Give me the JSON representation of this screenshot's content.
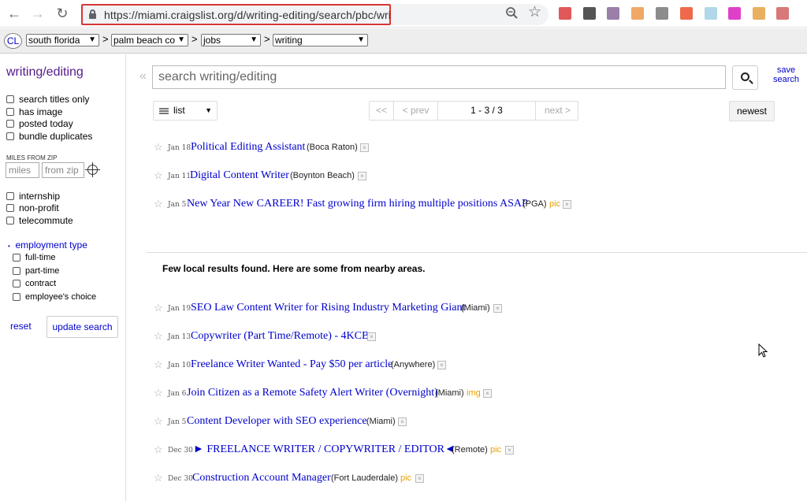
{
  "browser": {
    "url": "https://miami.craigslist.org/d/writing-editing/search/pbc/wri",
    "back_glyph": "←",
    "forward_glyph": "→",
    "reload_glyph": "↻",
    "star_glyph": "☆"
  },
  "header": {
    "logo": "CL",
    "sep": ">",
    "crumbs": [
      "south florida",
      "palm beach co",
      "jobs",
      "writing"
    ]
  },
  "sidebar": {
    "title": "writing/editing",
    "filters_top": [
      "search titles only",
      "has image",
      "posted today",
      "bundle duplicates"
    ],
    "miles_label": "MILES FROM ZIP",
    "miles_placeholder": "miles",
    "zip_placeholder": "from zip",
    "filters_mid": [
      "internship",
      "non-profit",
      "telecommute"
    ],
    "employment_type": "employment type",
    "employment_options": [
      "full-time",
      "part-time",
      "contract",
      "employee's choice"
    ],
    "reset": "reset",
    "update": "update search"
  },
  "main": {
    "collapse_glyph": "«",
    "search_placeholder": "search writing/editing",
    "save_search": "save search",
    "view_label": "list",
    "pager": {
      "first": "<<",
      "prev": "< prev",
      "range": "1 - 3 / 3",
      "next": "next >"
    },
    "sort": "newest",
    "nearby_note": "Few local results found. Here are some from nearby areas."
  },
  "local_results": [
    {
      "date": "Jan 18",
      "title": "Political Editing Assistant",
      "hood": "(Boca Raton)",
      "tag": ""
    },
    {
      "date": "Jan 11",
      "title": "Digital Content Writer",
      "hood": "(Boynton Beach)",
      "tag": ""
    },
    {
      "date": "Jan 5",
      "title": "New Year New CAREER! Fast growing firm hiring multiple positions ASAP",
      "hood": "(PGA)",
      "tag": "pic"
    }
  ],
  "nearby_results": [
    {
      "date": "Jan 19",
      "title": "SEO Law Content Writer for Rising Industry Marketing Giant",
      "hood": "(Miami)",
      "tag": ""
    },
    {
      "date": "Jan 13",
      "title": "Copywriter (Part Time/Remote) - 4KCB",
      "hood": "",
      "tag": ""
    },
    {
      "date": "Jan 10",
      "title": "Freelance Writer Wanted - Pay $50 per article",
      "hood": "(Anywhere)",
      "tag": ""
    },
    {
      "date": "Jan 6",
      "title": "Join Citizen as a Remote Safety Alert Writer (Overnight)",
      "hood": "(Miami)",
      "tag": "img"
    },
    {
      "date": "Jan 5",
      "title": "Content Developer with SEO experience",
      "hood": "(Miami)",
      "tag": ""
    },
    {
      "date": "Dec 30",
      "title": "► FREELANCE WRITER / COPYWRITER / EDITOR◄",
      "hood": "(Remote)",
      "tag": "pic"
    },
    {
      "date": "Dec 30",
      "title": "Construction Account Manager",
      "hood": "(Fort Lauderdale)",
      "tag": "pic"
    }
  ],
  "colors": {
    "link": "#0000cc",
    "visited": "#551a8b",
    "tag": "#e8a000",
    "url_highlight": "#d93636"
  }
}
